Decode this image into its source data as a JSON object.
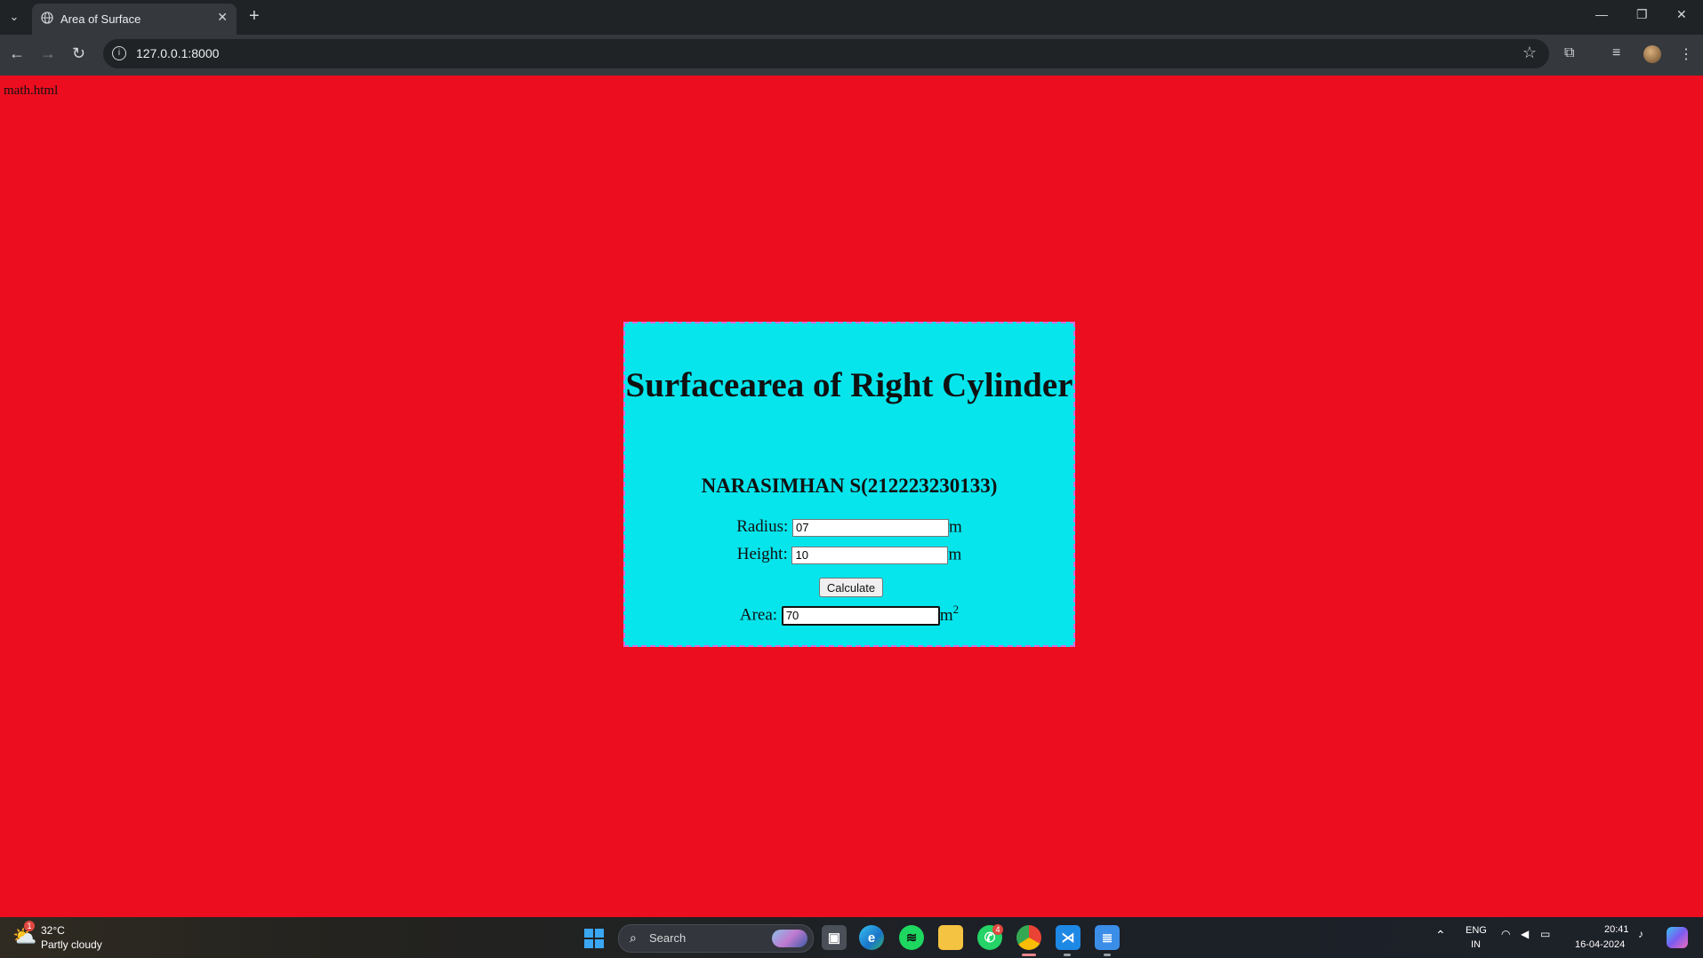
{
  "browser": {
    "tab_title": "Area of Surface",
    "url": "127.0.0.1:8000",
    "new_tab_glyph": "+",
    "close_glyph": "✕"
  },
  "page": {
    "filename": "math.html",
    "heading": "Surfacearea of Right Cylinder",
    "author": "NARASIMHAN S(212223230133)",
    "radius_label": "Radius:",
    "radius_value": "07",
    "height_label": "Height:",
    "height_value": "10",
    "unit": "m",
    "calculate_label": "Calculate",
    "area_label": "Area:",
    "area_value": "70",
    "area_unit": "m",
    "area_exponent": "2"
  },
  "taskbar": {
    "temperature": "32°C",
    "weather": "Partly cloudy",
    "weather_badge": "1",
    "search_label": "Search",
    "whatsapp_badge": "4",
    "language": "ENG",
    "region": "IN",
    "time": "20:41",
    "date": "16-04-2024"
  },
  "colors": {
    "page_background": "#ec0d1f",
    "card_background": "#06e5ec",
    "card_border": "#d96adc"
  }
}
